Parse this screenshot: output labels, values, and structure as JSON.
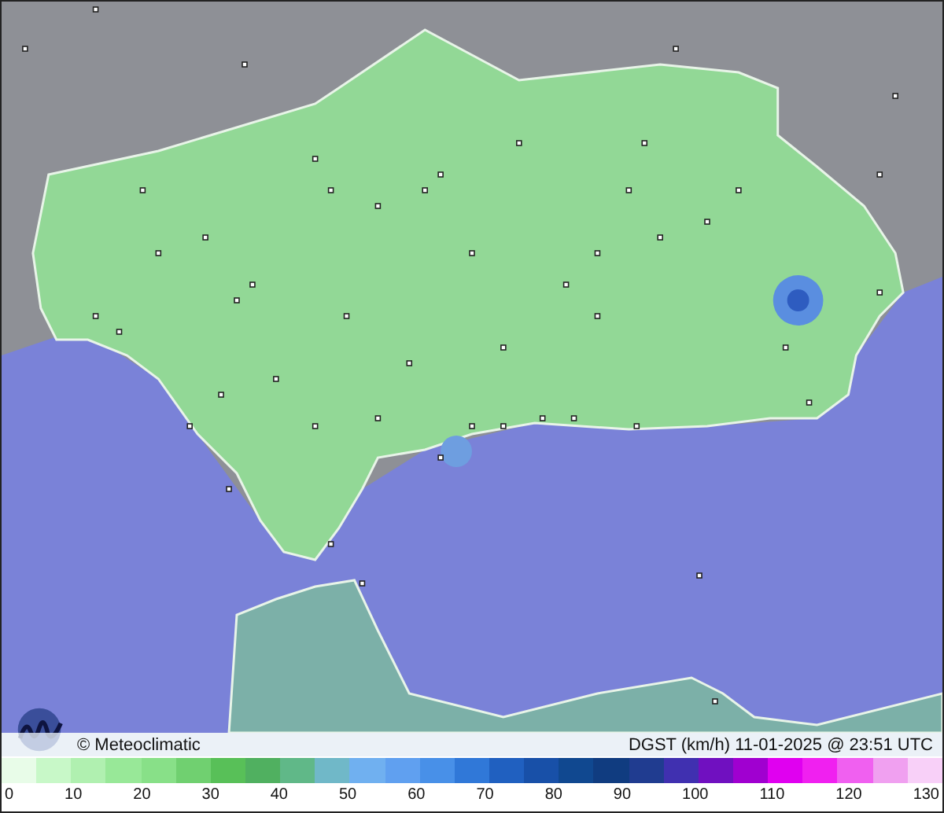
{
  "map": {
    "copyright": "© Meteoclimatic",
    "caption": "DGST (km/h)  11-01-2025 @ 23:51  UTC"
  },
  "legend": {
    "swatches": [
      {
        "color": "#e8fce8"
      },
      {
        "color": "#c8f8c8"
      },
      {
        "color": "#b0f0b0"
      },
      {
        "color": "#98e898"
      },
      {
        "color": "#88e088"
      },
      {
        "color": "#70d070"
      },
      {
        "color": "#58c058"
      },
      {
        "color": "#50b060"
      },
      {
        "color": "#60b888"
      },
      {
        "color": "#70b8c8"
      },
      {
        "color": "#70b0f0"
      },
      {
        "color": "#60a0f0"
      },
      {
        "color": "#4890e8"
      },
      {
        "color": "#3078d8"
      },
      {
        "color": "#2060c0"
      },
      {
        "color": "#1850a8"
      },
      {
        "color": "#104890"
      },
      {
        "color": "#103c80"
      },
      {
        "color": "#203c90"
      },
      {
        "color": "#4030b0"
      },
      {
        "color": "#7010c0"
      },
      {
        "color": "#a000d0"
      },
      {
        "color": "#e000f0"
      },
      {
        "color": "#f020f0"
      },
      {
        "color": "#f060f0"
      },
      {
        "color": "#f0a0f0"
      },
      {
        "color": "#f8d0f8"
      }
    ],
    "ticks": [
      "0",
      "10",
      "20",
      "30",
      "40",
      "50",
      "60",
      "70",
      "80",
      "90",
      "100",
      "110",
      "120",
      "130"
    ]
  }
}
